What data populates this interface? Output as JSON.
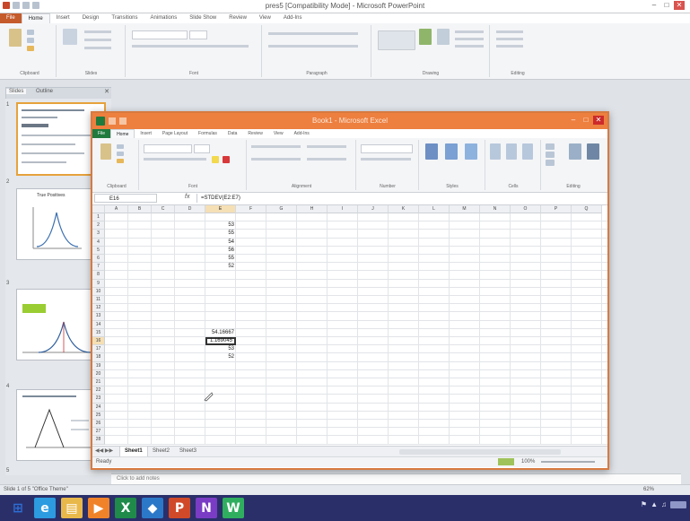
{
  "powerpoint": {
    "title": "pres5 [Compatibility Mode] - Microsoft PowerPoint",
    "tabs": [
      "File",
      "Home",
      "Insert",
      "Design",
      "Transitions",
      "Animations",
      "Slide Show",
      "Review",
      "View",
      "Add-Ins"
    ],
    "active_tab": "Home",
    "ribbon_groups": [
      "Clipboard",
      "Slides",
      "Font",
      "Paragraph",
      "Drawing",
      "Editing"
    ],
    "pane_tabs": [
      "Slides",
      "Outline"
    ],
    "thumbnails": [
      {
        "number": "1"
      },
      {
        "number": "2",
        "title": "True Positives"
      },
      {
        "number": "3"
      },
      {
        "number": "4"
      },
      {
        "number": "5"
      }
    ],
    "notes_placeholder": "Click to add notes",
    "status_left": "Slide 1 of 5   \"Office Theme\"",
    "status_zoom": "62%"
  },
  "excel": {
    "title": "Book1 - Microsoft Excel",
    "tabs": [
      "File",
      "Home",
      "Insert",
      "Page Layout",
      "Formulas",
      "Data",
      "Review",
      "View",
      "Add-Ins"
    ],
    "active_tab": "Home",
    "ribbon_groups": [
      "Clipboard",
      "Font",
      "Alignment",
      "Number",
      "Styles",
      "Cells",
      "Editing"
    ],
    "name_box": "E16",
    "fx_symbol": "fx",
    "formula": "=STDEV(E2:E7)",
    "columns": [
      "A",
      "B",
      "C",
      "D",
      "E",
      "F",
      "G",
      "H",
      "I",
      "J",
      "K",
      "L",
      "M",
      "N",
      "O",
      "P",
      "Q"
    ],
    "selected_column": "E",
    "rows": [
      "1",
      "2",
      "3",
      "4",
      "5",
      "6",
      "7",
      "8",
      "9",
      "10",
      "11",
      "12",
      "13",
      "14",
      "15",
      "16",
      "17",
      "18",
      "19",
      "20",
      "21",
      "22",
      "23",
      "24",
      "25",
      "26",
      "27",
      "28"
    ],
    "selected_row": "16",
    "cells": [
      {
        "row": 2,
        "col": "E",
        "value": "53"
      },
      {
        "row": 3,
        "col": "E",
        "value": "55"
      },
      {
        "row": 4,
        "col": "E",
        "value": "54"
      },
      {
        "row": 5,
        "col": "E",
        "value": "56"
      },
      {
        "row": 6,
        "col": "E",
        "value": "55"
      },
      {
        "row": 7,
        "col": "E",
        "value": "52"
      },
      {
        "row": 15,
        "col": "E",
        "value": "54.16667"
      },
      {
        "row": 16,
        "col": "E",
        "value": "1.169045",
        "active": true
      },
      {
        "row": 17,
        "col": "E",
        "value": "53"
      },
      {
        "row": 18,
        "col": "E",
        "value": "52"
      }
    ],
    "sheets": [
      "Sheet1",
      "Sheet2",
      "Sheet3"
    ],
    "active_sheet": "Sheet1",
    "status": "Ready",
    "zoom": "100%"
  },
  "taskbar": {
    "apps": [
      {
        "icon": "windows-start-icon",
        "color": "#2d6fd6"
      },
      {
        "icon": "internet-explorer-icon",
        "color": "#2c9be0"
      },
      {
        "icon": "file-explorer-icon",
        "color": "#e9b84a"
      },
      {
        "icon": "media-player-icon",
        "color": "#f0832a"
      },
      {
        "icon": "excel-icon",
        "color": "#1f8a4a"
      },
      {
        "icon": "app-icon",
        "color": "#2b78c8"
      },
      {
        "icon": "powerpoint-icon",
        "color": "#d04a29"
      },
      {
        "icon": "onenote-icon",
        "color": "#7a3cc4"
      },
      {
        "icon": "word-icon",
        "color": "#2fae5f"
      }
    ]
  }
}
